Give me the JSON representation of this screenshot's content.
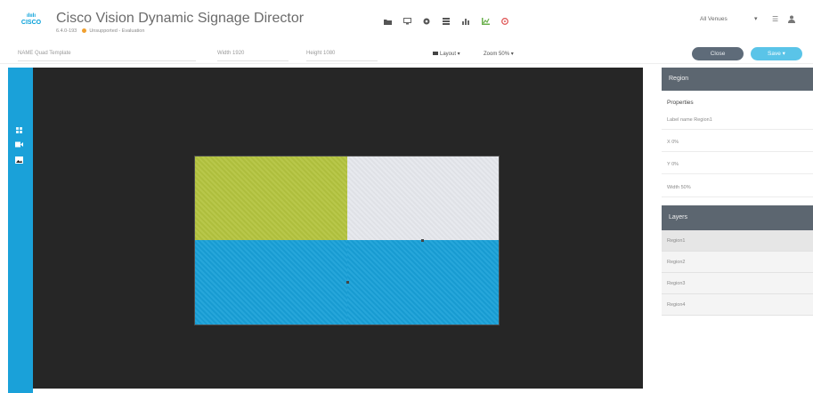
{
  "header": {
    "logo_top": "ılıılı",
    "logo_text": "CISCO",
    "title": "Cisco Vision Dynamic Signage Director",
    "version": "6.4.0-193",
    "environment": "Unsupported - Evaluation",
    "toolbar_icons": [
      "folder-icon",
      "monitor-icon",
      "gear-icon",
      "grid-icon",
      "chart-icon",
      "chart-green-icon",
      "settings-red-icon"
    ],
    "venue_select": "All Venues",
    "icons": [
      "list-icon",
      "user-icon"
    ]
  },
  "toolbar": {
    "name_label": "NAME",
    "name_value": "Quad Template",
    "width_label": "Width",
    "width_value": "1920",
    "height_label": "Height",
    "height_value": "1080",
    "layout_label": "Layout",
    "zoom_label": "Zoom",
    "zoom_value": "50%",
    "close_label": "Close",
    "save_label": "Save"
  },
  "rail": {
    "icons": [
      "grid-icon",
      "video-icon",
      "image-icon"
    ]
  },
  "canvas": {
    "background": "#262626",
    "regions": [
      {
        "name": "Region1",
        "color": "#b4c43f"
      },
      {
        "name": "Region2",
        "color": "#e6e8ed"
      },
      {
        "name": "Region3",
        "color": "#19a0d8"
      },
      {
        "name": "Region4",
        "color": "#19a0d8"
      }
    ]
  },
  "panel": {
    "region_header": "Region",
    "properties_label": "Properties",
    "properties": [
      {
        "label": "Label name",
        "value": "Region1"
      },
      {
        "label": "X",
        "value": "0%"
      },
      {
        "label": "Y",
        "value": "0%"
      },
      {
        "label": "Width",
        "value": "50%"
      }
    ],
    "layers_header": "Layers",
    "layers": [
      "Region1",
      "Region2",
      "Region3",
      "Region4"
    ]
  }
}
